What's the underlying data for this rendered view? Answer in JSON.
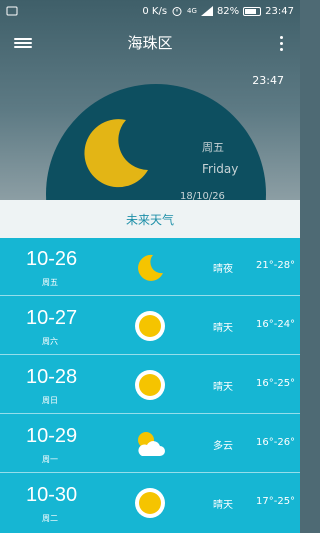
{
  "status_bar": {
    "network": "0 K/s",
    "signal": "4G",
    "battery": "82%",
    "time": "23:47"
  },
  "app_bar": {
    "city": "海珠区",
    "menu_icon": "hamburger-menu-icon",
    "more_icon": "more-vertical-icon"
  },
  "current": {
    "time": "23:47",
    "weekday_cn": "周五",
    "weekday_en": "Friday",
    "date": "18/10/26",
    "icon": "crescent-moon-icon"
  },
  "future": {
    "title": "未来天气",
    "days": [
      {
        "date": "10-26",
        "weekday": "周五",
        "icon": "moon",
        "desc": "晴夜",
        "temp": "21°-28°"
      },
      {
        "date": "10-27",
        "weekday": "周六",
        "icon": "sun",
        "desc": "晴天",
        "temp": "16°-24°"
      },
      {
        "date": "10-28",
        "weekday": "周日",
        "icon": "sun",
        "desc": "晴天",
        "temp": "16°-25°"
      },
      {
        "date": "10-29",
        "weekday": "周一",
        "icon": "partly-cloudy",
        "desc": "多云",
        "temp": "16°-26°"
      },
      {
        "date": "10-30",
        "weekday": "周二",
        "icon": "sun",
        "desc": "晴天",
        "temp": "17°-25°"
      }
    ]
  },
  "colors": {
    "list_bg": "#16b6d3",
    "header_bg": "#eef3f4",
    "header_text": "#1d8fa8",
    "sun": "#f5c400"
  }
}
